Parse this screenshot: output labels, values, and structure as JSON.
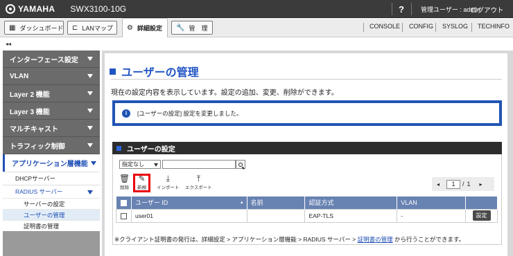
{
  "header": {
    "logo": "YAMAHA",
    "model": "SWX3100-10G",
    "help_label": "?",
    "admin_label": "管理ユーザー : admin",
    "logout_label": "ログアウト"
  },
  "menu": {
    "tabs": [
      {
        "label": "ダッシュボード",
        "icon": "dashboard-icon"
      },
      {
        "label": "LANマップ",
        "icon": "lanmap-icon"
      },
      {
        "label": "詳細設定",
        "icon": "gear-icon"
      },
      {
        "label": "管　理",
        "icon": "wrench-icon"
      }
    ],
    "right_links": [
      "CONSOLE",
      "CONFIG",
      "SYSLOG",
      "TECHINFO"
    ],
    "collapse_label": "◂◂"
  },
  "sidebar": {
    "items": [
      "インターフェース設定",
      "VLAN",
      "Layer 2 機能",
      "Layer 3 機能",
      "マルチキャスト",
      "トラフィック制御"
    ],
    "open_section": "アプリケーション層機能",
    "sub_items": [
      "DHCPサーバー",
      "RADIUS サーバー"
    ],
    "radius_children": [
      "サーバーの設定",
      "ユーザーの管理",
      "証明書の管理"
    ]
  },
  "main": {
    "title": "ユーザーの管理",
    "description": "現在の設定内容を表示しています。設定の追加、変更、削除ができます。",
    "notice": "[ユーザーの設定] 設定を変更しました。",
    "section_title": "ユーザーの設定",
    "filter_select": "指定なし",
    "search_value": "",
    "tools": {
      "delete": "削除",
      "new": "新規",
      "import": "インポート",
      "export": "エクスポート"
    },
    "pager": {
      "prev": "◂",
      "current": "1",
      "sep": "/",
      "total": "1",
      "next": "▸"
    },
    "columns": [
      "ユーザー ID",
      "名前",
      "認証方式",
      "VLAN"
    ],
    "rows": [
      {
        "user_id": "user01",
        "name": "",
        "auth": "EAP-TLS",
        "vlan": "-",
        "action": "設定"
      }
    ],
    "footnote_prefix": "※クライアント証明書の発行は、詳細設定 > アプリケーション層機能 > RADIUS サーバー > ",
    "footnote_link": "証明書の管理",
    "footnote_suffix": " から行うことができます。"
  }
}
